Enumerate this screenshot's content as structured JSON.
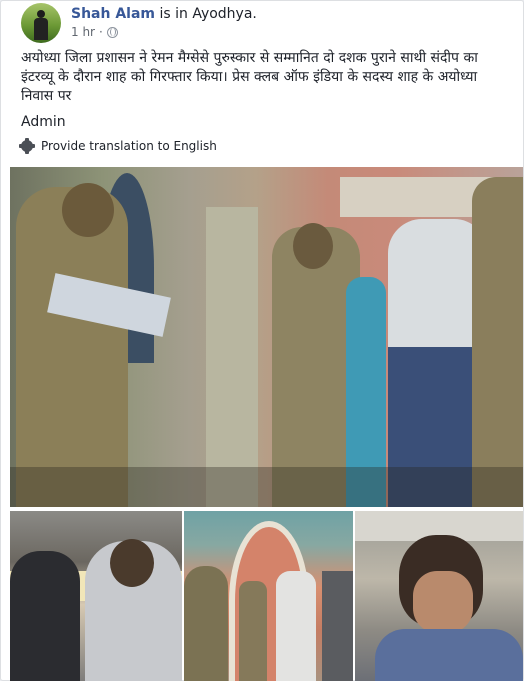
{
  "post": {
    "author": "Shah Alam",
    "location_text": "is in Ayodhya.",
    "time": "1 hr",
    "time_sep": "·",
    "text": "अयोध्या जिला प्रशासन ने रेमन मैग्सेसे पुरुस्कार से सम्मानित दो दशक पुराने साथी संदीप का इंटरव्यू के दौरान शाह को गिरफ्तार किया। प्रेस क्लब ऑफ इंडिया के सदस्य शाह के अयोध्या निवास पर",
    "signature": "Admin",
    "translate_label": "Provide translation to English"
  },
  "icons": [
    "avatar-photo",
    "globe-icon",
    "gear-icon"
  ],
  "colors": {
    "author_link": "#385898",
    "text": "#1d2129",
    "muted": "#616770"
  }
}
